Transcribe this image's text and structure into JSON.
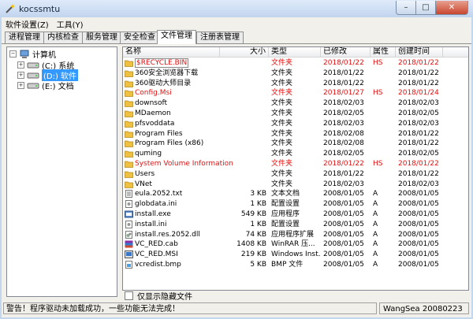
{
  "window": {
    "title": "kocssmtu",
    "min_glyph": "–",
    "max_glyph": "□",
    "close_glyph": "✕"
  },
  "menu": [
    "软件设置(Z)",
    "工具(Y)"
  ],
  "tabs": [
    {
      "label": "进程管理",
      "active": false
    },
    {
      "label": "内核检查",
      "active": false
    },
    {
      "label": "服务管理",
      "active": false
    },
    {
      "label": "安全检查",
      "active": false
    },
    {
      "label": "文件管理",
      "active": true
    },
    {
      "label": "注册表管理",
      "active": false
    }
  ],
  "tree": {
    "root": "计算机",
    "drives": [
      {
        "label": "(C:) 系统",
        "selected": false
      },
      {
        "label": "(D:) 软件",
        "selected": true
      },
      {
        "label": "(E:) 文档",
        "selected": false
      }
    ]
  },
  "list": {
    "columns": [
      "名称",
      "大小",
      "类型",
      "已修改",
      "属性",
      "创建时间"
    ],
    "rows": [
      {
        "name": "$RECYCLE.BIN",
        "size": "",
        "type": "文件夹",
        "modified": "2018/01/22",
        "attr": "HS",
        "created": "2018/01/22",
        "red": true,
        "boxed": true,
        "icon": "folder"
      },
      {
        "name": "360安全浏览器下载",
        "size": "",
        "type": "文件夹",
        "modified": "2018/01/22",
        "attr": "",
        "created": "2018/01/22",
        "red": false,
        "icon": "folder"
      },
      {
        "name": "360驱动大师目录",
        "size": "",
        "type": "文件夹",
        "modified": "2018/01/22",
        "attr": "",
        "created": "2018/01/22",
        "red": false,
        "icon": "folder"
      },
      {
        "name": "Config.Msi",
        "size": "",
        "type": "文件夹",
        "modified": "2018/01/27",
        "attr": "HS",
        "created": "2018/01/24",
        "red": true,
        "icon": "folder"
      },
      {
        "name": "downsoft",
        "size": "",
        "type": "文件夹",
        "modified": "2018/02/03",
        "attr": "",
        "created": "2018/02/03",
        "red": false,
        "icon": "folder"
      },
      {
        "name": "MDaemon",
        "size": "",
        "type": "文件夹",
        "modified": "2018/02/05",
        "attr": "",
        "created": "2018/02/05",
        "red": false,
        "icon": "folder"
      },
      {
        "name": "pfsvoddata",
        "size": "",
        "type": "文件夹",
        "modified": "2018/02/03",
        "attr": "",
        "created": "2018/02/03",
        "red": false,
        "icon": "folder"
      },
      {
        "name": "Program Files",
        "size": "",
        "type": "文件夹",
        "modified": "2018/02/08",
        "attr": "",
        "created": "2018/01/22",
        "red": false,
        "icon": "folder"
      },
      {
        "name": "Program Files (x86)",
        "size": "",
        "type": "文件夹",
        "modified": "2018/02/08",
        "attr": "",
        "created": "2018/01/22",
        "red": false,
        "icon": "folder"
      },
      {
        "name": "quming",
        "size": "",
        "type": "文件夹",
        "modified": "2018/02/05",
        "attr": "",
        "created": "2018/02/05",
        "red": false,
        "icon": "folder"
      },
      {
        "name": "System Volume Information",
        "size": "",
        "type": "文件夹",
        "modified": "2018/01/22",
        "attr": "HS",
        "created": "2018/01/22",
        "red": true,
        "icon": "folder"
      },
      {
        "name": "Users",
        "size": "",
        "type": "文件夹",
        "modified": "2018/01/22",
        "attr": "",
        "created": "2018/01/22",
        "red": false,
        "icon": "folder"
      },
      {
        "name": "VNet",
        "size": "",
        "type": "文件夹",
        "modified": "2018/02/03",
        "attr": "",
        "created": "2018/02/03",
        "red": false,
        "icon": "folder"
      },
      {
        "name": "eula.2052.txt",
        "size": "3 KB",
        "type": "文本文档",
        "modified": "2008/01/05",
        "attr": "A",
        "created": "2008/01/05",
        "red": false,
        "icon": "doc"
      },
      {
        "name": "globdata.ini",
        "size": "1 KB",
        "type": "配置设置",
        "modified": "2008/01/05",
        "attr": "A",
        "created": "2008/01/05",
        "red": false,
        "icon": "ini"
      },
      {
        "name": "install.exe",
        "size": "549 KB",
        "type": "应用程序",
        "modified": "2008/01/05",
        "attr": "A",
        "created": "2008/01/05",
        "red": false,
        "icon": "exe"
      },
      {
        "name": "install.ini",
        "size": "1 KB",
        "type": "配置设置",
        "modified": "2008/01/05",
        "attr": "A",
        "created": "2008/01/05",
        "red": false,
        "icon": "ini"
      },
      {
        "name": "install.res.2052.dll",
        "size": "74 KB",
        "type": "应用程序扩展",
        "modified": "2008/01/05",
        "attr": "A",
        "created": "2008/01/05",
        "red": false,
        "icon": "dll"
      },
      {
        "name": "VC_RED.cab",
        "size": "1408 KB",
        "type": "WinRAR 压...",
        "modified": "2008/01/05",
        "attr": "A",
        "created": "2008/01/05",
        "red": false,
        "icon": "cab"
      },
      {
        "name": "VC_RED.MSI",
        "size": "219 KB",
        "type": "Windows Inst...",
        "modified": "2008/01/05",
        "attr": "A",
        "created": "2008/01/05",
        "red": false,
        "icon": "msi"
      },
      {
        "name": "vcredist.bmp",
        "size": "5 KB",
        "type": "BMP 文件",
        "modified": "2008/01/05",
        "attr": "A",
        "created": "2008/01/05",
        "red": false,
        "icon": "bmp"
      }
    ]
  },
  "show_hidden_label": "仅显示隐藏文件",
  "status": {
    "message": "警告！程序驱动未加载成功，一些功能无法完成！",
    "author": "WangSea 20080223"
  },
  "colors": {
    "selection": "#3399ff",
    "hidden_file": "#e01010",
    "folder": "#f0c040"
  }
}
